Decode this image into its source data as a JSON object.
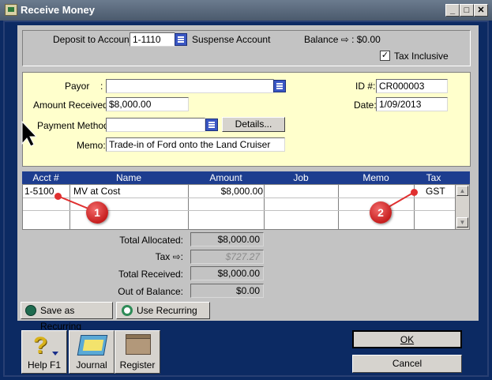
{
  "window": {
    "title": "Receive Money"
  },
  "titlebar_buttons": {
    "minimize": "_",
    "maximize": "□",
    "close": "✕"
  },
  "header": {
    "deposit_label": "Deposit to Account:",
    "deposit_account": "1-1110",
    "deposit_account_name": "Suspense Account",
    "balance_label": "Balance ⇨ : $0.00",
    "tax_inclusive_label": "Tax Inclusive",
    "tax_inclusive_checked": true,
    "checkmark": "✓"
  },
  "details": {
    "payor_label": "Payor",
    "payor_colon": ":",
    "payor_value": "",
    "amount_label": "Amount Received:",
    "amount_value": "$8,000.00",
    "payment_method_label": "Payment Method:",
    "payment_method_value": "",
    "details_button": "Details...",
    "memo_label": "Memo:",
    "memo_value": "Trade-in of Ford onto the Land Cruiser",
    "id_label": "ID #:",
    "id_value": "CR000003",
    "date_label": "Date:",
    "date_value": "1/09/2013"
  },
  "grid": {
    "headers": [
      "Acct #",
      "Name",
      "Amount",
      "Job",
      "Memo",
      "Tax"
    ],
    "rows": [
      {
        "acct": "1-5100",
        "name": "MV at Cost",
        "amount": "$8,000.00",
        "job": "",
        "memo": "",
        "tax": "GST"
      }
    ],
    "scroll_up": "▲",
    "scroll_down": "▼"
  },
  "annotations": {
    "badge1": "1",
    "badge2": "2"
  },
  "totals": {
    "allocated_label": "Total Allocated:",
    "allocated_value": "$8,000.00",
    "tax_label": "Tax ⇨:",
    "tax_value": "$727.27",
    "received_label": "Total Received:",
    "received_value": "$8,000.00",
    "out_of_balance_label": "Out of Balance:",
    "out_of_balance_value": "$0.00"
  },
  "recurring": {
    "save_label": "Save as Recurring",
    "use_label": "Use Recurring"
  },
  "toolbar": {
    "help_label": "Help F1",
    "journal_label": "Journal",
    "register_label": "Register"
  },
  "actions": {
    "ok_label": "OK",
    "cancel_label": "Cancel"
  },
  "colors": {
    "frame": "#0c2a63",
    "panel": "#c3c3c3",
    "yellow": "#ffffcc",
    "grid_header": "#1d3d8f",
    "annotation": "#e03030"
  }
}
